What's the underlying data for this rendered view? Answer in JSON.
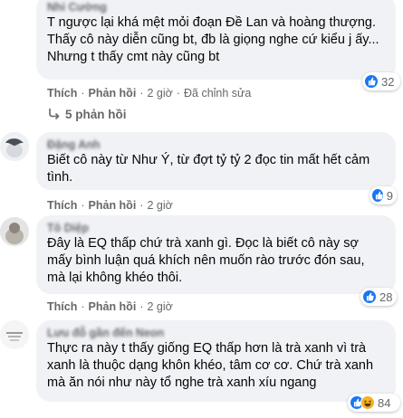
{
  "comments": [
    {
      "author": "Nhi Cường",
      "text": "T ngược lại khá mệt mỏi đoạn Đề Lan và hoàng thượng.\nThấy cô này diễn cũng bt, đb là giọng nghe cứ kiểu j ấy...\nNhưng t thấy cmt này cũng bt",
      "like_label": "Thích",
      "reply_label": "Phản hồi",
      "time": "2 giờ",
      "edited": "Đã chỉnh sửa",
      "reaction_count": "32",
      "replies_label": "5 phản hồi"
    },
    {
      "author": "Đặng Anh",
      "text": "Biết cô này từ Như Ý, từ đợt tỷ tỷ 2 đọc tin mất hết cảm tình.",
      "like_label": "Thích",
      "reply_label": "Phản hồi",
      "time": "2 giờ",
      "reaction_count": "9"
    },
    {
      "author": "Tô Diệp",
      "text": "Đây là EQ thấp chứ trà xanh gì. Đọc là biết cô này sợ mấy bình luận quá khích nên muốn rào trước đón sau, mà lại không khéo thôi.",
      "like_label": "Thích",
      "reply_label": "Phản hồi",
      "time": "2 giờ",
      "reaction_count": "28"
    },
    {
      "author": "Lưu đỗ gần đến Neon",
      "text": "Thực ra này t thấy giống EQ thấp hơn là trà xanh vì trà xanh là thuộc dạng khôn khéo, tâm cơ cơ. Chứ trà xanh mà ăn nói như này tổ nghe trà xanh xíu ngang",
      "like_label": "Thích",
      "reply_label": "Phản hồi",
      "time": "2 giờ",
      "reaction_count": "84"
    }
  ],
  "colors": {
    "bubble": "#f0f2f5",
    "meta": "#65676b",
    "like_blue": "#1877f2",
    "haha_yellow": "#f7b125"
  },
  "icons": [
    "like-reaction-icon",
    "haha-reaction-icon",
    "reply-arrow-icon"
  ]
}
